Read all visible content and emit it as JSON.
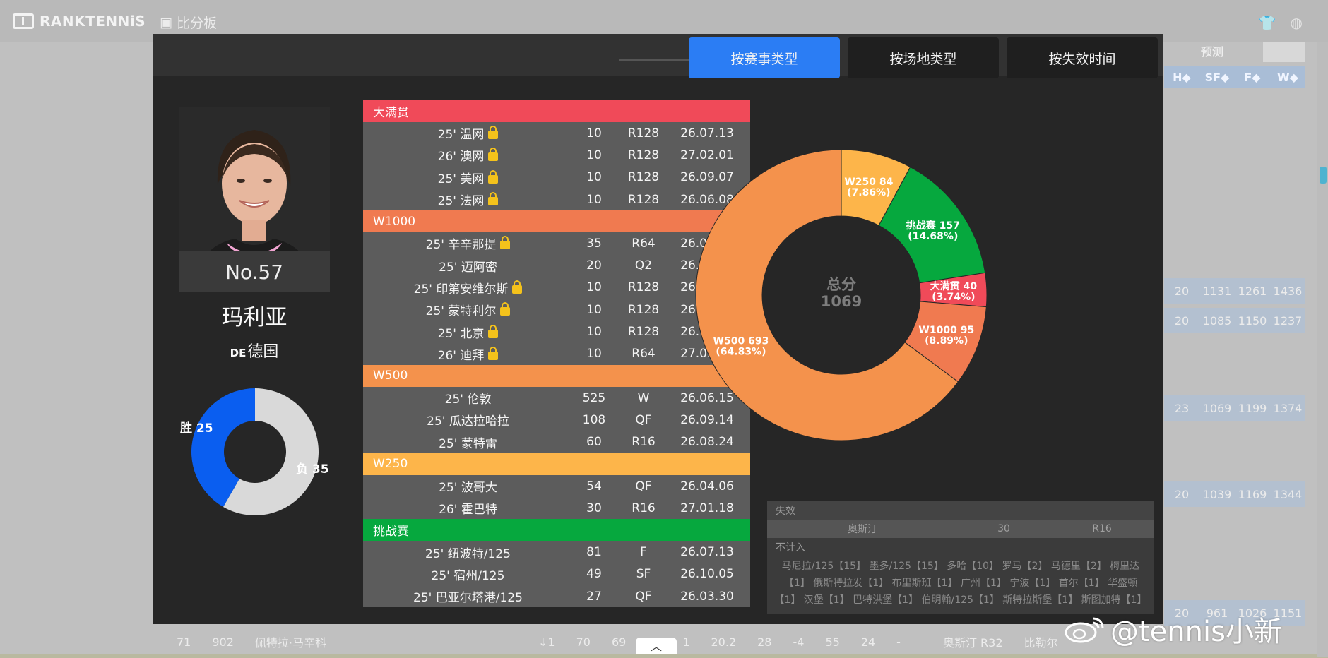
{
  "background": {
    "logo_text": "RANKTENNiS",
    "score_tab_label": "比分板",
    "col_headers": {
      "predict": "预测",
      "sf": "SF",
      "f": "F",
      "w": "W"
    },
    "rows": [
      {
        "a": "1131",
        "b": "1261",
        "c": "1436"
      },
      {
        "a": "1085",
        "b": "1150",
        "c": "1237"
      },
      {
        "a": "1069",
        "b": "1199",
        "c": "1374"
      },
      {
        "a": "1039",
        "b": "1169",
        "c": "1344"
      },
      {
        "a": "961",
        "b": "1026",
        "c": "1151"
      }
    ],
    "footer_row": [
      "71",
      "902",
      "佩特拉·马辛科",
      "↓1",
      "70",
      "69",
      "1",
      "20.2",
      "28",
      "-4",
      "55",
      "24",
      "-",
      "奥斯汀 R32",
      "比勒尔"
    ]
  },
  "tabs": [
    {
      "label": "按赛事类型",
      "active": true
    },
    {
      "label": "按场地类型",
      "active": false
    },
    {
      "label": "按失效时间",
      "active": false
    }
  ],
  "player": {
    "rank": "No.57",
    "name": "玛利亚",
    "country_code": "DE",
    "country": "德国",
    "wins_label": "胜 25",
    "losses_label": "负 35",
    "wins": 25,
    "losses": 35
  },
  "colors": {
    "grand_slam": "#f04a59",
    "w1000": "#f07a50",
    "w500": "#f4924c",
    "w250": "#fdb54a",
    "challenger": "#06a83e",
    "win": "#0a5ef0",
    "loss": "#d9d9d9",
    "tab_active": "#2b7df4"
  },
  "table": [
    {
      "category": "大满贯",
      "color": "#f04a59",
      "events": [
        {
          "name": "25' 温网",
          "locked": true,
          "points": "10",
          "round": "R128",
          "date": "26.07.13"
        },
        {
          "name": "26' 澳网",
          "locked": true,
          "points": "10",
          "round": "R128",
          "date": "27.02.01"
        },
        {
          "name": "25' 美网",
          "locked": true,
          "points": "10",
          "round": "R128",
          "date": "26.09.07"
        },
        {
          "name": "25' 法网",
          "locked": true,
          "points": "10",
          "round": "R128",
          "date": "26.06.08"
        }
      ]
    },
    {
      "category": "W1000",
      "color": "#f07a50",
      "events": [
        {
          "name": "25' 辛辛那提",
          "locked": true,
          "points": "35",
          "round": "R64",
          "date": "26.08.17"
        },
        {
          "name": "25' 迈阿密",
          "locked": false,
          "points": "20",
          "round": "Q2",
          "date": "26.03.30"
        },
        {
          "name": "25' 印第安维尔斯",
          "locked": true,
          "points": "10",
          "round": "R128",
          "date": "26.03.16"
        },
        {
          "name": "25' 蒙特利尔",
          "locked": true,
          "points": "10",
          "round": "R128",
          "date": "26.08.10"
        },
        {
          "name": "25' 北京",
          "locked": true,
          "points": "10",
          "round": "R128",
          "date": "26.10.05"
        },
        {
          "name": "26' 迪拜",
          "locked": true,
          "points": "10",
          "round": "R64",
          "date": "27.02.22"
        }
      ]
    },
    {
      "category": "W500",
      "color": "#f4924c",
      "events": [
        {
          "name": "25' 伦敦",
          "locked": false,
          "points": "525",
          "round": "W",
          "date": "26.06.15"
        },
        {
          "name": "25' 瓜达拉哈拉",
          "locked": false,
          "points": "108",
          "round": "QF",
          "date": "26.09.14"
        },
        {
          "name": "25' 蒙特雷",
          "locked": false,
          "points": "60",
          "round": "R16",
          "date": "26.08.24"
        }
      ]
    },
    {
      "category": "W250",
      "color": "#fdb54a",
      "events": [
        {
          "name": "25' 波哥大",
          "locked": false,
          "points": "54",
          "round": "QF",
          "date": "26.04.06"
        },
        {
          "name": "26' 霍巴特",
          "locked": false,
          "points": "30",
          "round": "R16",
          "date": "27.01.18"
        }
      ]
    },
    {
      "category": "挑战赛",
      "color": "#06a83e",
      "events": [
        {
          "name": "25' 纽波特/125",
          "locked": false,
          "points": "81",
          "round": "F",
          "date": "26.07.13"
        },
        {
          "name": "25' 宿州/125",
          "locked": false,
          "points": "49",
          "round": "SF",
          "date": "26.10.05"
        },
        {
          "name": "25' 巴亚尔塔港/125",
          "locked": false,
          "points": "27",
          "round": "QF",
          "date": "26.03.30"
        }
      ]
    }
  ],
  "chart_data": {
    "type": "pie",
    "center_label": "总分",
    "center_value": "1069",
    "slices": [
      {
        "name": "W500",
        "value": 693,
        "label": "W500 693",
        "pct": "(64.83%)",
        "color": "#f4924c"
      },
      {
        "name": "W250",
        "value": 84,
        "label": "W250 84",
        "pct": "(7.86%)",
        "color": "#fdb54a"
      },
      {
        "name": "挑战赛",
        "value": 157,
        "label": "挑战赛 157",
        "pct": "(14.68%)",
        "color": "#06a83e"
      },
      {
        "name": "大满贯",
        "value": 40,
        "label": "大满贯 40",
        "pct": "(3.74%)",
        "color": "#f04a59"
      },
      {
        "name": "W1000",
        "value": 95,
        "label": "W1000 95",
        "pct": "(8.89%)",
        "color": "#f07a50"
      }
    ],
    "start_slice": "W250"
  },
  "expired": {
    "title": "失效",
    "row": {
      "event": "奥斯汀",
      "points": "30",
      "round": "R16"
    },
    "not_counted_label": "不计入",
    "not_counted_text": "马尼拉/125【15】 墨多/125【15】 多哈【10】 罗马【2】 马德里【2】 梅里达【1】 俄斯特拉发【1】 布里斯班【1】 广州【1】 宁波【1】 首尔【1】 华盛顿【1】 汉堡【1】 巴特洪堡【1】 伯明翰/125【1】 斯特拉斯堡【1】 斯图加特【1】"
  },
  "watermark": "@tennis小新"
}
